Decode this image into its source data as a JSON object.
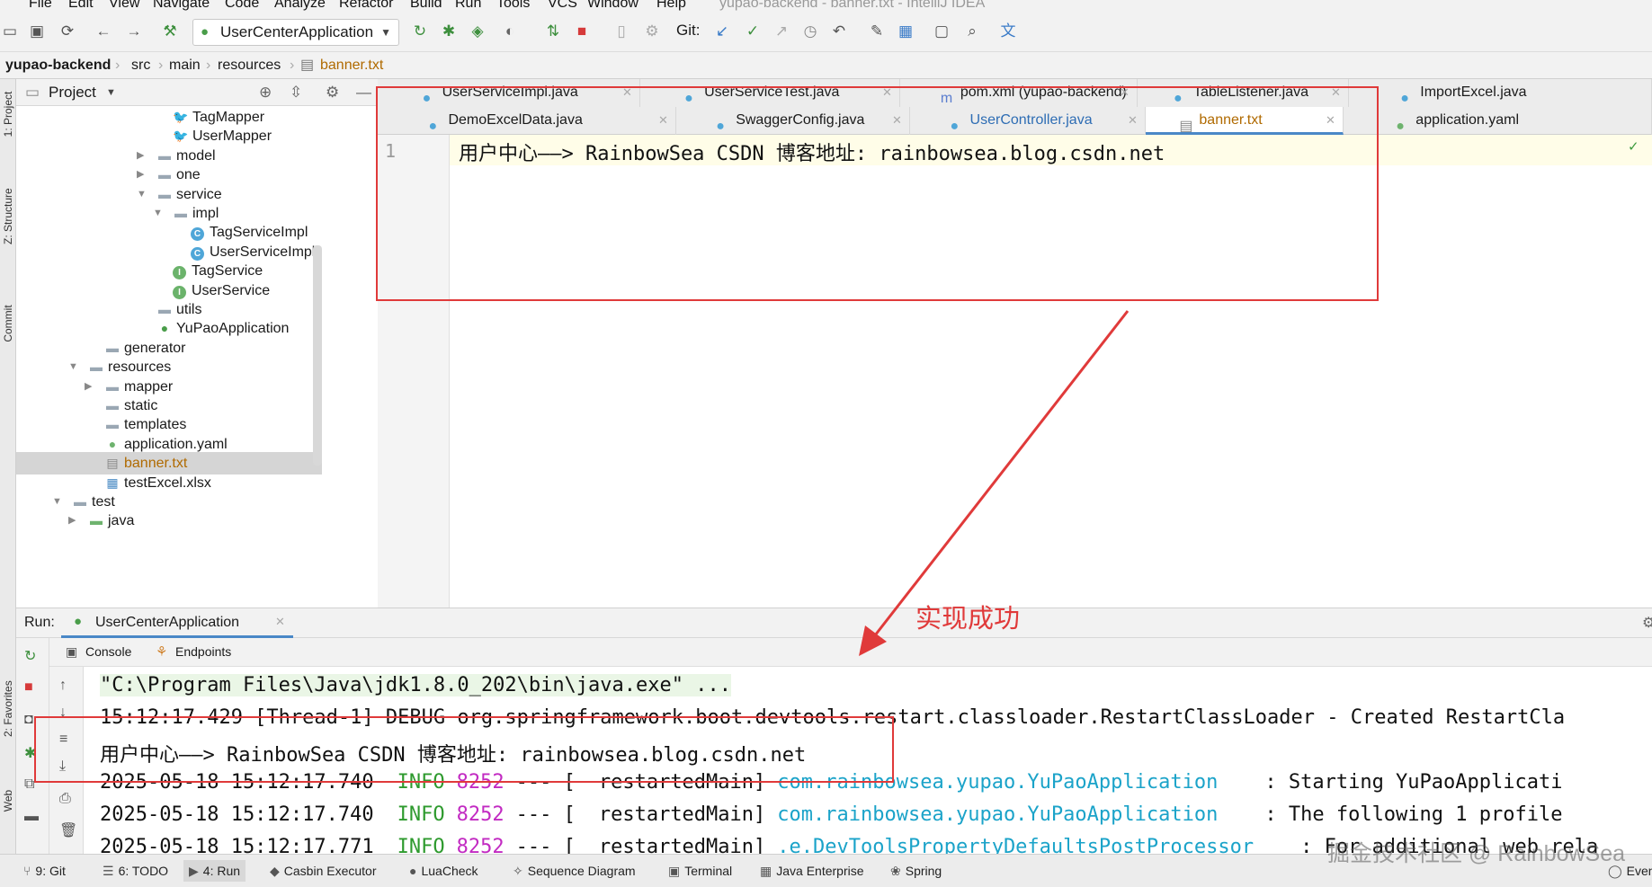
{
  "menubar": {
    "items": [
      "File",
      "Edit",
      "View",
      "Navigate",
      "Code",
      "Analyze",
      "Refactor",
      "Build",
      "Run",
      "Tools",
      "VCS",
      "Window",
      "Help"
    ],
    "window_title": "yupao-backend - banner.txt - IntelliJ IDEA"
  },
  "toolbar": {
    "run_config": "UserCenterApplication",
    "git_label": "Git:"
  },
  "breadcrumb": [
    "yupao-backend",
    "src",
    "main",
    "resources",
    "banner.txt"
  ],
  "left_strip": [
    "1: Project",
    "Z: Structure",
    "Commit",
    "2: Favorites",
    "Web"
  ],
  "project_panel": {
    "title": "Project"
  },
  "tree": [
    {
      "label": "TagMapper",
      "icon": "mapper-icon",
      "level": 5,
      "arrow": ""
    },
    {
      "label": "UserMapper",
      "icon": "mapper-icon",
      "level": 5,
      "arrow": ""
    },
    {
      "label": "model",
      "icon": "folder-icon",
      "level": 4,
      "arrow": "▶"
    },
    {
      "label": "one",
      "icon": "folder-icon",
      "level": 4,
      "arrow": "▶"
    },
    {
      "label": "service",
      "icon": "folder-icon",
      "level": 4,
      "arrow": "▼"
    },
    {
      "label": "impl",
      "icon": "folder-icon",
      "level": 5,
      "arrow": "▼"
    },
    {
      "label": "TagServiceImpl",
      "icon": "class-icon",
      "level": 6,
      "arrow": ""
    },
    {
      "label": "UserServiceImpl",
      "icon": "class-icon",
      "level": 6,
      "arrow": ""
    },
    {
      "label": "TagService",
      "icon": "interface-icon",
      "level": 5,
      "arrow": ""
    },
    {
      "label": "UserService",
      "icon": "interface-icon",
      "level": 5,
      "arrow": ""
    },
    {
      "label": "utils",
      "icon": "folder-icon",
      "level": 4,
      "arrow": ""
    },
    {
      "label": "YuPaoApplication",
      "icon": "spring-app-icon",
      "level": 4,
      "arrow": ""
    },
    {
      "label": "generator",
      "icon": "folder-icon",
      "level": 3,
      "arrow": ""
    },
    {
      "label": "resources",
      "icon": "folder-icon",
      "level": 2,
      "arrow": "▼"
    },
    {
      "label": "mapper",
      "icon": "folder-icon",
      "level": 3,
      "arrow": "▶"
    },
    {
      "label": "static",
      "icon": "folder-icon",
      "level": 3,
      "arrow": ""
    },
    {
      "label": "templates",
      "icon": "folder-icon",
      "level": 3,
      "arrow": ""
    },
    {
      "label": "application.yaml",
      "icon": "yaml-icon",
      "level": 3,
      "arrow": ""
    },
    {
      "label": "banner.txt",
      "icon": "text-file-icon",
      "level": 3,
      "arrow": "",
      "selected": true
    },
    {
      "label": "testExcel.xlsx",
      "icon": "excel-file-icon",
      "level": 3,
      "arrow": ""
    },
    {
      "label": "test",
      "icon": "folder-icon",
      "level": 1,
      "arrow": "▼"
    },
    {
      "label": "java",
      "icon": "folder-green-icon",
      "level": 2,
      "arrow": "▶"
    }
  ],
  "tabs_row1": [
    {
      "label": "UserServiceImpl.java",
      "icon": "class-icon"
    },
    {
      "label": "UserServiceTest.java",
      "icon": "class-icon"
    },
    {
      "label": "pom.xml (yupao-backend)",
      "icon": "maven-icon"
    },
    {
      "label": "TableListener.java",
      "icon": "class-icon"
    },
    {
      "label": "ImportExcel.java",
      "icon": "class-icon"
    }
  ],
  "tabs_row2": [
    {
      "label": "DemoExcelData.java",
      "icon": "class-icon"
    },
    {
      "label": "SwaggerConfig.java",
      "icon": "class-icon"
    },
    {
      "label": "UserController.java",
      "icon": "class-icon"
    },
    {
      "label": "banner.txt",
      "icon": "text-file-icon",
      "active": true
    },
    {
      "label": "application.yaml",
      "icon": "yaml-icon"
    }
  ],
  "editor": {
    "line_number": "1",
    "line_text": "用户中心——> RainbowSea CSDN 博客地址: rainbowsea.blog.csdn.net"
  },
  "run_panel": {
    "run_label": "Run:",
    "app_tab": "UserCenterApplication",
    "sub_tabs": [
      "Console",
      "Endpoints"
    ],
    "console_lines": [
      "\"C:\\Program Files\\Java\\jdk1.8.0_202\\bin\\java.exe\" ...",
      "15:12:17.429 [Thread-1] DEBUG org.springframework.boot.devtools.restart.classloader.RestartClassLoader - Created RestartCla",
      "用户中心——> RainbowSea CSDN 博客地址: rainbowsea.blog.csdn.net"
    ],
    "log_lines": [
      {
        "date": "2025-05-18 15:12:17.740",
        "level": "INFO",
        "pid": "8252",
        "sep": "--- [",
        "thread": "restartedMain]",
        "logger": "com.rainbowsea.yupao.YuPaoApplication",
        "msg": ": Starting YuPaoApplicati"
      },
      {
        "date": "2025-05-18 15:12:17.740",
        "level": "INFO",
        "pid": "8252",
        "sep": "--- [",
        "thread": "restartedMain]",
        "logger": "com.rainbowsea.yupao.YuPaoApplication",
        "msg": ": The following 1 profile"
      },
      {
        "date": "2025-05-18 15:12:17.771",
        "level": "INFO",
        "pid": "8252",
        "sep": "--- [",
        "thread": "restartedMain]",
        "logger": ".e.DevToolsPropertyDefaultsPostProcessor",
        "msg": ": For additional web rela"
      }
    ]
  },
  "annotation": "实现成功",
  "watermark": "掘金技术社区 @ RainbowSea",
  "statusbar": [
    {
      "label": "9: Git",
      "icon": "git-icon"
    },
    {
      "label": "6: TODO",
      "icon": "todo-icon"
    },
    {
      "label": "4: Run",
      "icon": "run-icon",
      "active": true
    },
    {
      "label": "Casbin Executor",
      "icon": "casbin-icon"
    },
    {
      "label": "LuaCheck",
      "icon": "lua-icon"
    },
    {
      "label": "Sequence Diagram",
      "icon": "sequence-icon"
    },
    {
      "label": "Terminal",
      "icon": "terminal-icon"
    },
    {
      "label": "Java Enterprise",
      "icon": "java-enterprise-icon"
    },
    {
      "label": "Spring",
      "icon": "spring-icon"
    },
    {
      "label": "Event",
      "icon": "event-log-icon"
    }
  ],
  "colors": {
    "annotation_red": "#e03a3a",
    "logger_cyan": "#1ba3c9",
    "info_green": "#2e9a2e",
    "pid_magenta": "#c22ac2",
    "file_orange": "#b06a00",
    "accent_blue": "#4a88c7"
  }
}
